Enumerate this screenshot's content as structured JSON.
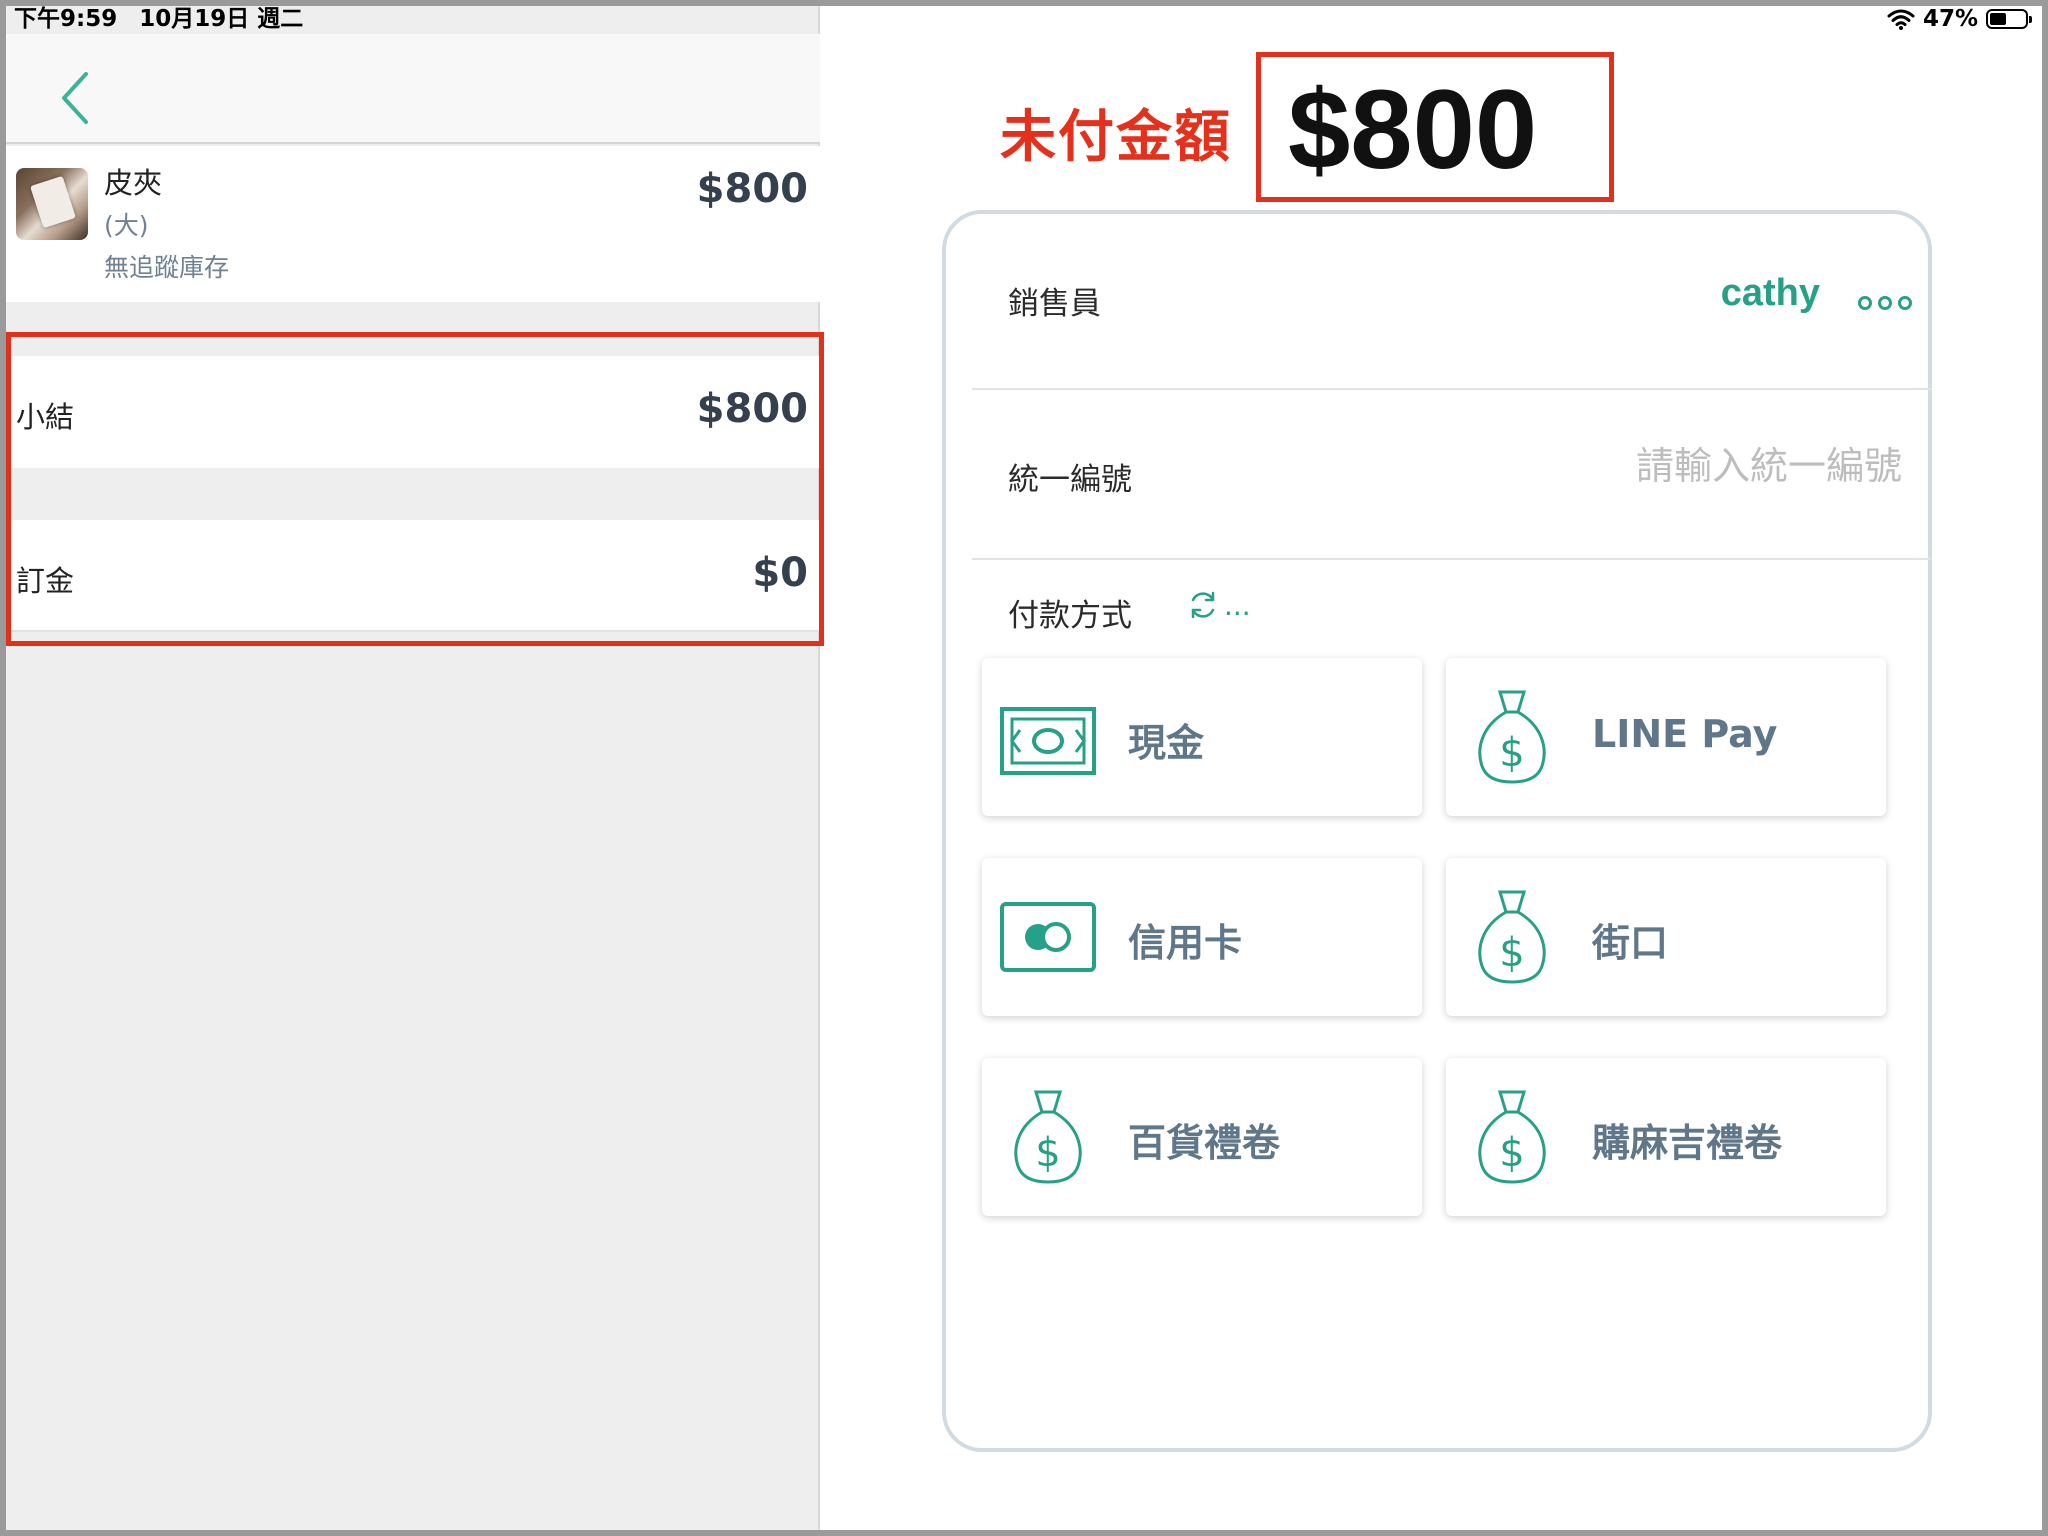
{
  "status_bar": {
    "time": "下午9:59",
    "date": "10月19日 週二",
    "battery": "47%",
    "battery_level": 0.47
  },
  "order": {
    "item": {
      "name": "皮夾",
      "variant": "(大)",
      "stock_note": "無追蹤庫存",
      "price": "$800"
    },
    "subtotal": {
      "label": "小結",
      "value": "$800"
    },
    "deposit": {
      "label": "訂金",
      "value": "$0"
    }
  },
  "payment": {
    "unpaid_label": "未付金額",
    "unpaid_amount": "$800",
    "salesperson_label": "銷售員",
    "salesperson_value": "cathy",
    "tax_id_label": "統一編號",
    "tax_id_placeholder": "請輸入統一編號",
    "tax_id_value": "",
    "method_label": "付款方式",
    "refresh_ellipsis": "...",
    "methods": [
      {
        "label": "現金",
        "icon": "cash-icon"
      },
      {
        "label": "LINE Pay",
        "icon": "money-bag-icon"
      },
      {
        "label": "信用卡",
        "icon": "credit-card-icon"
      },
      {
        "label": "街口",
        "icon": "money-bag-icon"
      },
      {
        "label": "百貨禮卷",
        "icon": "money-bag-icon"
      },
      {
        "label": "購麻吉禮卷",
        "icon": "money-bag-icon"
      }
    ]
  },
  "colors": {
    "accent": "#26a086",
    "highlight": "#e0311f",
    "text_muted": "#6f8192"
  }
}
